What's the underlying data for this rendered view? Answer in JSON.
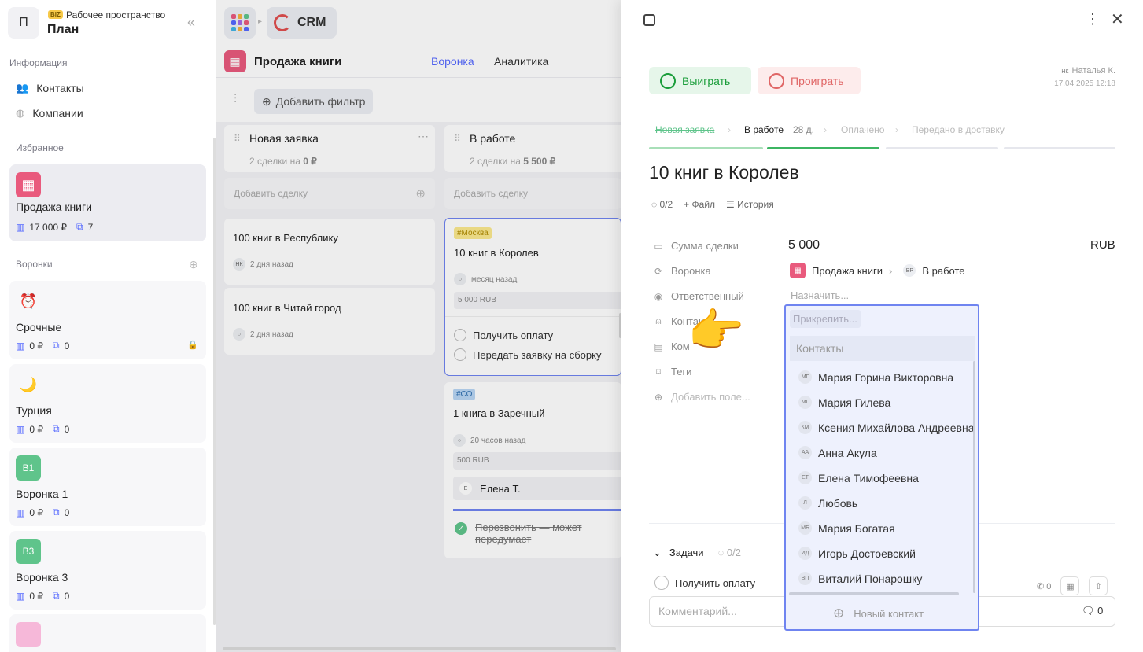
{
  "workspace": {
    "avatar": "П",
    "badge": "BIZ",
    "name": "Рабочее пространство",
    "plan": "План"
  },
  "sidebar": {
    "info_title": "Информация",
    "contacts": "Контакты",
    "companies": "Компании",
    "favorites_title": "Избранное",
    "favorite": {
      "title": "Продажа книги",
      "amount": "17 000 ₽",
      "count": "7"
    },
    "funnels_title": "Воронки",
    "funnels": [
      {
        "title": "Срочные",
        "amount": "0 ₽",
        "count": "0",
        "icon": "⏰"
      },
      {
        "title": "Турция",
        "amount": "0 ₽",
        "count": "0",
        "icon": "🌙"
      },
      {
        "title": "Воронка 1",
        "amount": "0 ₽",
        "count": "0",
        "icon": "В1"
      },
      {
        "title": "Воронка 3",
        "amount": "0 ₽",
        "count": "0",
        "icon": "В3"
      }
    ]
  },
  "topbar": {
    "crm": "CRM",
    "board_title": "Продажа книги",
    "tab_funnel": "Воронка",
    "tab_analytics": "Аналитика",
    "add_filter": "Добавить фильтр"
  },
  "board": {
    "columns": [
      {
        "name": "Новая заявка",
        "meta": "2 сделки на",
        "meta_sum": "0 ₽",
        "add": "Добавить сделку"
      },
      {
        "name": "В работе",
        "meta": "2 сделки на",
        "meta_sum": "5 500 ₽",
        "add": "Добавить сделку"
      }
    ],
    "deals_col1": [
      {
        "title": "100 книг в Республику",
        "avatar": "НК",
        "time": "2 дня назад"
      },
      {
        "title": "100 книг в Читай город",
        "time": "2 дня назад"
      }
    ],
    "deal_moscow": {
      "tag": "#Москва",
      "title": "10 книг в Королев",
      "time": "месяц назад",
      "amount": "5 000 RUB",
      "task1": "Получить оплату",
      "task2": "Передать заявку на сборку"
    },
    "deal_co": {
      "tag": "#СО",
      "title": "1 книга в Заречный",
      "time": "20 часов назад",
      "amount": "500 RUB",
      "assignee_av": "Е",
      "assignee": "Елена Т.",
      "task": "Перезвонить — может передумает"
    }
  },
  "panel": {
    "win": "Выиграть",
    "lose": "Проиграть",
    "author_av": "НК",
    "author": "Наталья К.",
    "date": "17.04.2025 12:18",
    "stages": [
      "Новая заявка",
      "В работе",
      "28 д.",
      "Оплачено",
      "Передано в доставку"
    ],
    "title": "10 книг в Королев",
    "progress": "0/2",
    "file": "Файл",
    "history": "История",
    "fields": {
      "sum": "Сумма сделки",
      "funnel": "Воронка",
      "responsible": "Ответственный",
      "contact": "Контакт",
      "company": "Ком",
      "tags": "Теги",
      "add_field": "Добавить поле..."
    },
    "sum_value": "5 000",
    "currency": "RUB",
    "funnel_value": "Продажа книги",
    "stage_av": "ВР",
    "stage_value": "В работе",
    "assign": "Назначить...",
    "tasks_title": "Задачи",
    "tasks_progress": "0/2",
    "task": "Получить оплату",
    "task_calls": "0",
    "comment_placeholder": "Комментарий...",
    "comment_count": "0"
  },
  "dropdown": {
    "attach": "Прикрепить...",
    "header": "Контакты",
    "items": [
      {
        "av": "МГ",
        "name": "Мария Горина Викторовна"
      },
      {
        "av": "МГ",
        "name": "Мария Гилева"
      },
      {
        "av": "КМ",
        "name": "Ксения Михайлова Андреевна"
      },
      {
        "av": "АА",
        "name": "Анна Акула"
      },
      {
        "av": "ЕТ",
        "name": "Елена Тимофеевна"
      },
      {
        "av": "Л",
        "name": "Любовь"
      },
      {
        "av": "МБ",
        "name": "Мария Богатая"
      },
      {
        "av": "ИД",
        "name": "Игорь Достоевский"
      },
      {
        "av": "ВП",
        "name": "Виталий Понарошку"
      }
    ],
    "new_contact": "Новый контакт"
  },
  "colors": {
    "accent": "#5468ff",
    "win": "#1a9d3a",
    "lose": "#e06666",
    "dropdown_border": "#6f84f0"
  }
}
